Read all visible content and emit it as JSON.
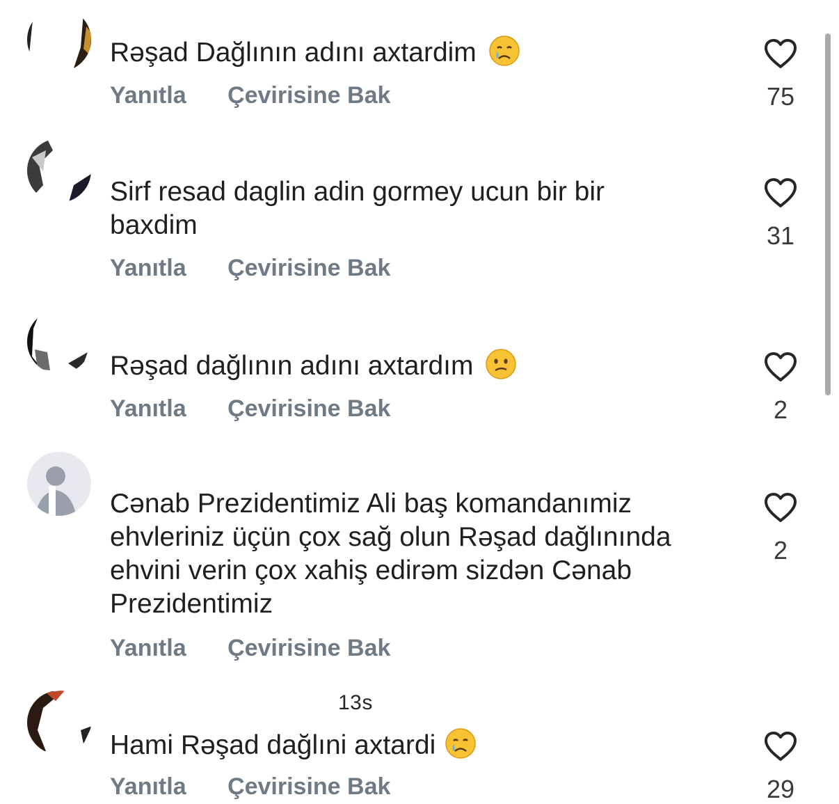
{
  "comments": [
    {
      "username": "",
      "time": "",
      "text": "Rəşad Dağlının adını axtardim",
      "emoji": "crying-face-emoji",
      "reply_label": "Yanıtla",
      "translate_label": "Çevirisine Bak",
      "likes": "75"
    },
    {
      "username": "",
      "time": "",
      "text": "Sirf resad daglin adin gormey ucun bir bir baxdim",
      "emoji": "",
      "reply_label": "Yanıtla",
      "translate_label": "Çevirisine Bak",
      "likes": "31"
    },
    {
      "username": "",
      "time": "",
      "text": "Rəşad dağlının adını axtardım",
      "emoji": "confused-face-emoji",
      "reply_label": "Yanıtla",
      "translate_label": "Çevirisine Bak",
      "likes": "2"
    },
    {
      "username": "",
      "time": "",
      "text": "Cənab Prezidentimiz Ali baş komandanımiz ehvleriniz üçün çox sağ olun Rəşad dağlınında ehvini verin çox xahiş edirəm sizdən Cənab Prezidentimiz",
      "emoji": "",
      "reply_label": "Yanıtla",
      "translate_label": "Çevirisine Bak",
      "likes": "2"
    },
    {
      "username": "",
      "time": "13s",
      "text": "Hami Rəşad dağlıni axtardi",
      "emoji": "crying-face-emoji",
      "reply_label": "Yanıtla",
      "translate_label": "Çevirisine Bak",
      "likes": "29"
    }
  ],
  "colors": {
    "action_text": "#6e7a86",
    "body_text": "#1f1f1f",
    "heart_outline": "#262626",
    "scrollbar": "#a9a9a9"
  }
}
